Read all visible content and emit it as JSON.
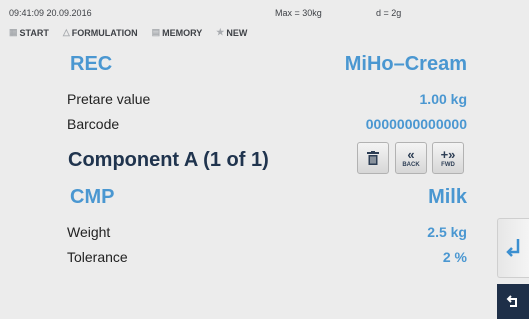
{
  "status": {
    "datetime": "09:41:09 20.09.2016",
    "max": "Max = 30kg",
    "d": "d = 2g"
  },
  "nav": {
    "items": [
      "START",
      "FORMULATION",
      "MEMORY",
      "NEW"
    ]
  },
  "recipe": {
    "key": "REC",
    "name": "MiHo–Cream"
  },
  "fields": {
    "pretare_label": "Pretare value",
    "pretare_value": "1.00 kg",
    "barcode_label": "Barcode",
    "barcode_value": "0000000000000"
  },
  "component": {
    "title": "Component A (1 of 1)"
  },
  "controls": {
    "back_caption": "BACK",
    "fwd_caption": "FWD"
  },
  "cmp": {
    "key": "CMP",
    "name": "Milk"
  },
  "target": {
    "weight_label": "Weight",
    "weight_value": "2.5 kg",
    "tolerance_label": "Tolerance",
    "tolerance_value": "2 %"
  },
  "icons": [
    "home-icon",
    "flask-icon",
    "memory-icon",
    "star-icon",
    "trash-icon",
    "back-icon",
    "forward-icon",
    "enter-icon",
    "return-icon"
  ],
  "colors": {
    "accent": "#4a97d1",
    "heading": "#20344e",
    "background": "#ececec",
    "return_button": "#1e2f48"
  }
}
